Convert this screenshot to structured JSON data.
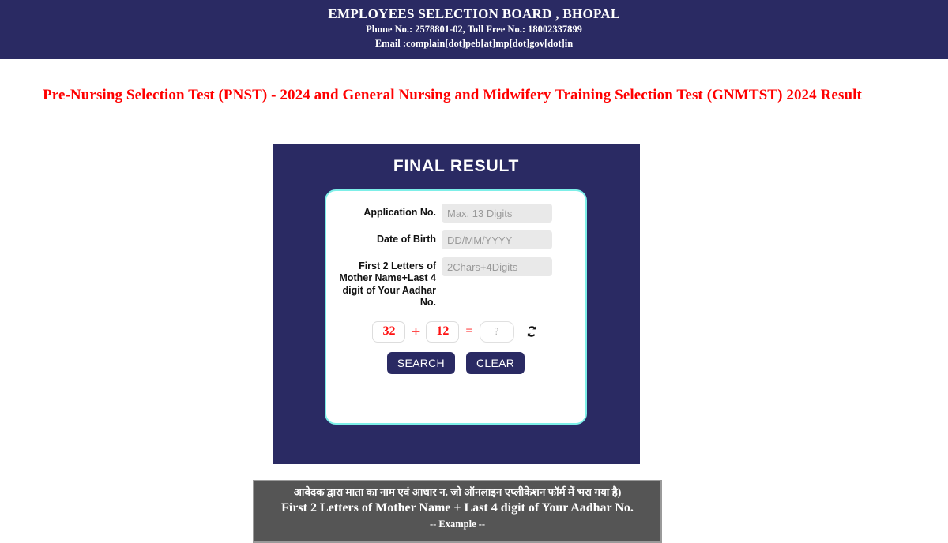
{
  "header": {
    "org_title": "EMPLOYEES SELECTION BOARD , BHOPAL",
    "phone_line": "Phone No.: 2578801-02, Toll Free No.: 18002337899",
    "email_line": "Email :complain[dot]peb[at]mp[dot]gov[dot]in",
    "background_color": "#2a2a63"
  },
  "page": {
    "title": "Pre-Nursing Selection Test (PNST) - 2024 and General Nursing and Midwifery Training Selection Test (GNMTST) 2024 Result",
    "title_color": "#ff0000"
  },
  "result_panel": {
    "heading": "FINAL RESULT",
    "background_color": "#2a2a63",
    "card_border_color": "#7defe8",
    "fields": [
      {
        "label": "Application No.",
        "placeholder": "Max. 13 Digits",
        "value": ""
      },
      {
        "label": "Date of Birth",
        "placeholder": "DD/MM/YYYY",
        "value": ""
      },
      {
        "label": "First 2 Letters of Mother Name+Last 4 digit of Your Aadhar No.",
        "placeholder": "2Chars+4Digits",
        "value": ""
      }
    ],
    "captcha": {
      "operand_1": "32",
      "operator": "+",
      "operand_2": "12",
      "equals": "=",
      "answer_placeholder": "?",
      "answer_value": "",
      "refresh_icon": "refresh-icon",
      "number_color": "#ff1111"
    },
    "buttons": {
      "search_label": "SEARCH",
      "clear_label": "CLEAR",
      "color": "#2a2a63"
    }
  },
  "note_banner": {
    "hindi_line": "आवेदक द्वारा माता का नाम  एवं आधार न. जो ऑनलाइन एप्लीकेशन फॉर्म में भरा गया है)",
    "english_line": "First 2 Letters of Mother Name + Last 4 digit of Your Aadhar No.",
    "example_line": "-- Example --",
    "background_color": "#555555"
  }
}
